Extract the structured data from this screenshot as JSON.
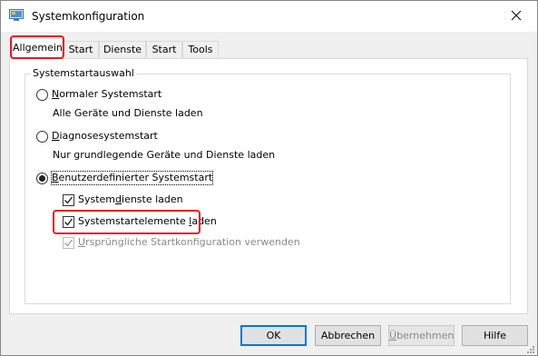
{
  "window": {
    "title": "Systemkonfiguration",
    "app_icon": "msconfig-icon",
    "close_icon": "close-icon"
  },
  "tabs": [
    {
      "label": "Allgemein",
      "active": true
    },
    {
      "label": "Start",
      "active": false
    },
    {
      "label": "Dienste",
      "active": false
    },
    {
      "label": "Start",
      "active": false
    },
    {
      "label": "Tools",
      "active": false
    }
  ],
  "startup_group": {
    "legend": "Systemstartauswahl",
    "options": [
      {
        "pre": "",
        "access": "N",
        "post": "ormaler Systemstart",
        "description": "Alle Geräte und Dienste laden",
        "selected": false
      },
      {
        "pre": "",
        "access": "D",
        "post": "iagnosesystemstart",
        "description": "Nur grundlegende Geräte und Dienste laden",
        "selected": false
      },
      {
        "pre": "",
        "access": "B",
        "post": "enutzerdefinierter Systemstart",
        "description": "",
        "selected": true
      }
    ],
    "checks": [
      {
        "pre": "System",
        "access": "d",
        "post": "ienste laden",
        "checked": true,
        "enabled": true
      },
      {
        "pre": "Systemstartelemente ",
        "access": "l",
        "post": "aden",
        "checked": true,
        "enabled": true
      },
      {
        "pre": "",
        "access": "U",
        "post": "rsprüngliche Startkonfiguration verwenden",
        "checked": true,
        "enabled": false
      }
    ]
  },
  "buttons": {
    "ok": "OK",
    "cancel": "Abbrechen",
    "apply_access": "Ü",
    "apply_rest": "bernehmen",
    "help": "Hilfe"
  },
  "colors": {
    "highlight": "#e31b23",
    "accent": "#0078d7",
    "window_bg": "#f0f0f0"
  }
}
